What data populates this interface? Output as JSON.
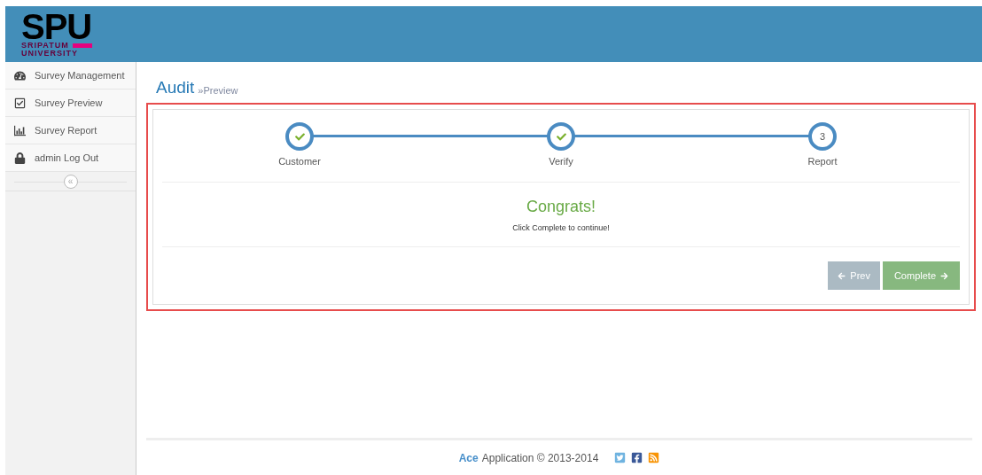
{
  "logo": {
    "mark": "SPU",
    "line_1": "SRIPATUM",
    "line_2": "UNIVERSITY"
  },
  "sidebar": {
    "items": [
      {
        "label": "Survey Management",
        "selected": false
      },
      {
        "label": "Survey Preview",
        "selected": false
      },
      {
        "label": "Survey Report",
        "selected": false
      },
      {
        "label": "admin Log Out",
        "selected": false
      }
    ],
    "collapse": "«"
  },
  "breadcrumb": {
    "title": "Audit",
    "sub": "»Preview"
  },
  "wizard": {
    "steps": [
      {
        "label": "Customer",
        "done": true
      },
      {
        "label": "Verify",
        "done": true
      },
      {
        "label": "Report",
        "done": false,
        "number": "3"
      }
    ],
    "heading": "Congrats!",
    "message": "Click Complete to continue!",
    "buttons": [
      {
        "kind": "prev",
        "label": "Prev",
        "disabled": true
      },
      {
        "kind": "next",
        "label": "Complete",
        "disabled": false
      }
    ]
  },
  "footer": {
    "brand": "Ace",
    "text": "Application © 2013-2014"
  }
}
